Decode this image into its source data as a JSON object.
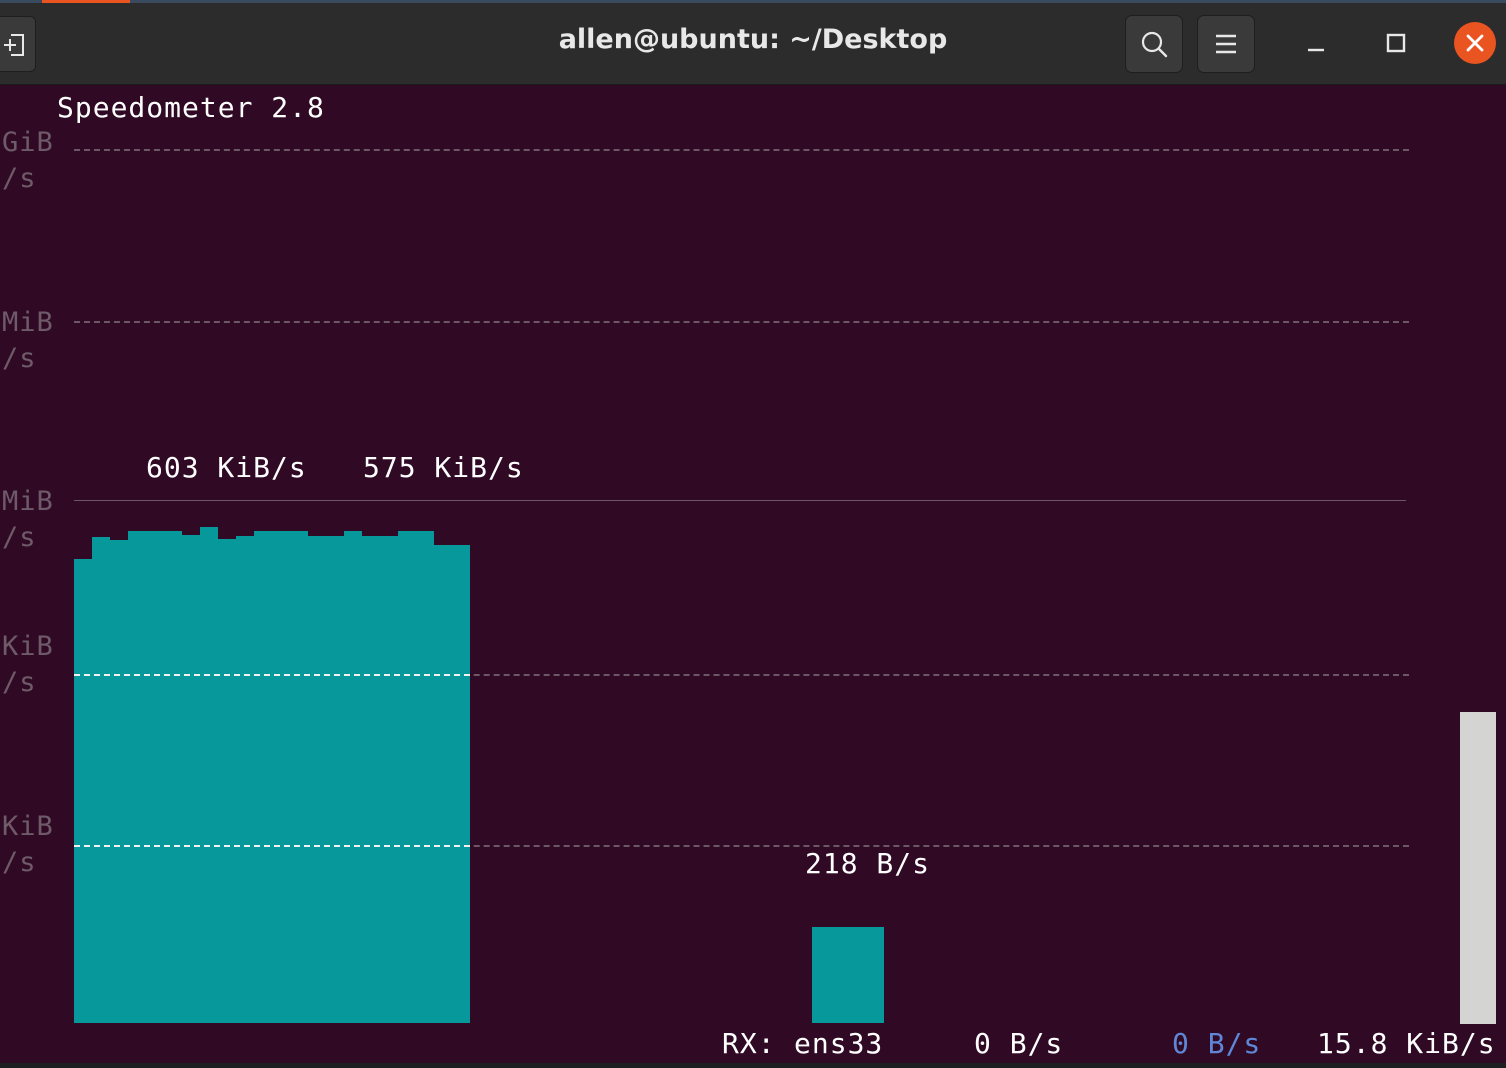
{
  "window": {
    "title": "allen@ubuntu: ~/Desktop",
    "buttons": [
      "new-tab",
      "search",
      "menu",
      "minimize",
      "maximize",
      "close"
    ]
  },
  "app": {
    "title": "Speedometer 2.8"
  },
  "graph": {
    "y_axis_labels": [
      {
        "unit": "GiB",
        "per": "/s"
      },
      {
        "unit": "MiB",
        "per": "/s"
      },
      {
        "unit": "MiB",
        "per": "/s"
      },
      {
        "unit": "KiB",
        "per": "/s"
      },
      {
        "unit": "KiB",
        "per": "/s"
      }
    ],
    "peak_labels": [
      "603 KiB/s",
      "575 KiB/s"
    ],
    "current_label": "218 B/s"
  },
  "status_line": {
    "direction": "RX:",
    "interface": "ens33",
    "current": "0 B/s",
    "average": "0 B/s",
    "peak": "15.8 KiB/s"
  },
  "colors": {
    "background": "#300a24",
    "bar": "#06989a",
    "axis_label": "#6e5a68",
    "close_button": "#e95420",
    "average_text": "#5f87d7"
  }
}
